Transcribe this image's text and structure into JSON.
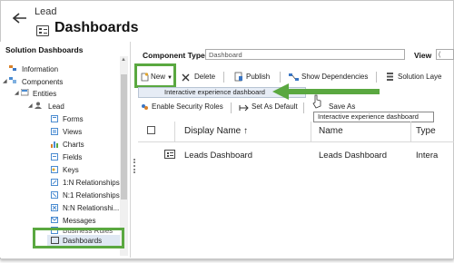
{
  "header": {
    "entity": "Lead",
    "title": "Dashboards"
  },
  "sidebar": {
    "title": "Solution Dashboards",
    "items": [
      {
        "label": "Information",
        "icon": "information-icon"
      },
      {
        "label": "Components",
        "icon": "components-icon"
      },
      {
        "label": "Entities",
        "icon": "entities-icon"
      },
      {
        "label": "Lead",
        "icon": "lead-icon"
      },
      {
        "label": "Forms",
        "icon": "forms-icon"
      },
      {
        "label": "Views",
        "icon": "views-icon"
      },
      {
        "label": "Charts",
        "icon": "charts-icon"
      },
      {
        "label": "Fields",
        "icon": "fields-icon"
      },
      {
        "label": "Keys",
        "icon": "keys-icon"
      },
      {
        "label": "1:N Relationships",
        "icon": "relationship-icon"
      },
      {
        "label": "N:1 Relationships",
        "icon": "relationship-icon"
      },
      {
        "label": "N:N Relationshi...",
        "icon": "relationship-icon"
      },
      {
        "label": "Messages",
        "icon": "messages-icon"
      },
      {
        "label": "Business Rules",
        "icon": "business-rules-icon"
      },
      {
        "label": "Dashboards",
        "icon": "dashboards-icon"
      }
    ]
  },
  "filters": {
    "component_type_label": "Component Type",
    "component_type_value": "Dashboard",
    "view_label": "View",
    "view_value": "("
  },
  "toolbar": {
    "new_label": "New",
    "delete_label": "Delete",
    "publish_label": "Publish",
    "show_dependencies_label": "Show Dependencies",
    "solution_layers_label": "Solution Laye",
    "enable_security_roles_label": "Enable Security Roles",
    "set_as_default_label": "Set As Default",
    "save_as_label": "Save As"
  },
  "dropdown": {
    "item": "Interactive experience dashboard"
  },
  "tooltip": {
    "text": "Interactive experience dashboard"
  },
  "grid": {
    "columns": [
      "Display Name ↑",
      "Name",
      "Type"
    ],
    "rows": [
      {
        "display_name": "Leads Dashboard",
        "name": "Leads Dashboard",
        "type": "Intera"
      }
    ]
  },
  "colors": {
    "highlight": "#5aa840",
    "dropdown_bg": "#e6ecf5"
  }
}
